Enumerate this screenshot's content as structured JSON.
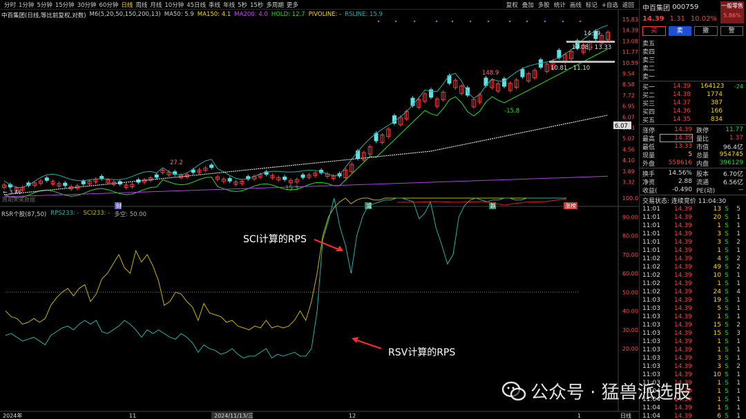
{
  "toolbar": {
    "timeframes": [
      "分时",
      "1分钟",
      "5分钟",
      "15分钟",
      "30分钟",
      "60分钟",
      "日线",
      "周线",
      "月线",
      "10分钟",
      "45日线",
      "季线",
      "年线",
      "5秒",
      "15秒",
      "多周期",
      "更多"
    ],
    "active_timeframe": "日线",
    "right_actions": [
      "复权",
      "叠加",
      "多股",
      "统计",
      "画线",
      "标记",
      "+自选",
      "返回"
    ]
  },
  "main_chart": {
    "title": "中百集团(日线,等比前复权,对数)",
    "indicators": [
      {
        "label": "M6(5,20,50,150,200,13)",
        "color": "#cccccc"
      },
      {
        "label": "MA50: 5.9",
        "color": "#cccccc"
      },
      {
        "label": "MA150: 4.1",
        "color": "#ffd700"
      },
      {
        "label": "MA200: 4.0",
        "color": "#d040ff"
      },
      {
        "label": "HOLD: 12.7",
        "color": "#1ee01e"
      },
      {
        "label": "PIVOLINE: -",
        "color": "#ffd700"
      },
      {
        "label": "RSLINE: 15.9",
        "color": "#20b2aa"
      }
    ],
    "y_axis": [
      "15.83",
      "14.39",
      "13.08",
      "11.77",
      "10.59",
      "9.54",
      "8.58",
      "7.72",
      "6.95",
      "6.07",
      "5.63",
      "5.07",
      "4.56",
      "4.10",
      "3.69",
      "3.32"
    ],
    "current_price_tag": "6.07",
    "annotations": {
      "high_label": "14.39",
      "range_upper": "13.08 - 13.33",
      "range_lower": "10.81 - 11.10",
      "peak_label": "148.9",
      "neg_label": "-15.8",
      "left_label": "27.2",
      "low_label": "15.3",
      "start_price": "3.46",
      "note": "周期未来数据"
    },
    "event_markers": [
      "财",
      "减",
      "跌",
      "涨榜"
    ]
  },
  "sub_chart": {
    "title": "RSR个股(87,50)",
    "rps_label": "RPS233: -",
    "sci_label": "SCI233: -",
    "multi_label": "多空: 50.00",
    "y_axis": [
      "100.0",
      "90.00",
      "80.00",
      "70.00",
      "60.00",
      "50.00",
      "40.00",
      "30.00",
      "20.00"
    ],
    "annotation_sci": "SCI计算的RPS",
    "annotation_rsv": "RSV计算的RPS"
  },
  "x_axis": {
    "labels": [
      "2024年",
      "11",
      "2024/11/13/三",
      "12",
      "1"
    ],
    "mode_label": "日线"
  },
  "chart_data": {
    "type": "line",
    "series": [
      {
        "name": "SCI233",
        "color": "#c8b400",
        "values": [
          40,
          37,
          36,
          33,
          34,
          36,
          34,
          36,
          43,
          47,
          50,
          52,
          48,
          52,
          54,
          45,
          49,
          57,
          60,
          65,
          70,
          63,
          60,
          72,
          66,
          70,
          64,
          56,
          43,
          45,
          50,
          49,
          45,
          42,
          35,
          44,
          39,
          38,
          37,
          34,
          35,
          32,
          31,
          30,
          32,
          31,
          35,
          31,
          32,
          31,
          32,
          35,
          40,
          35,
          45,
          60,
          80,
          90,
          95,
          98,
          100,
          97,
          99,
          100,
          100,
          99,
          99,
          100,
          100,
          100,
          100,
          100,
          100,
          100,
          100,
          100,
          100,
          100,
          100,
          100,
          100,
          100,
          100,
          100,
          100,
          100,
          100,
          100,
          100,
          100,
          100,
          100,
          100,
          100,
          100,
          100,
          100,
          100,
          100,
          100
        ]
      },
      {
        "name": "RPS233",
        "color": "#20b2aa",
        "values": [
          27,
          28,
          26,
          24,
          25,
          26,
          24,
          22,
          27,
          29,
          31,
          32,
          30,
          33,
          35,
          33,
          35,
          29,
          28,
          30,
          32,
          35,
          33,
          30,
          26,
          30,
          28,
          30,
          28,
          26,
          25,
          28,
          26,
          23,
          18,
          22,
          20,
          19,
          17,
          18,
          20,
          17,
          15,
          16,
          16,
          18,
          20,
          15,
          17,
          16,
          17,
          18,
          16,
          16,
          20,
          40,
          78,
          88,
          100,
          85,
          75,
          60,
          80,
          90,
          96,
          97,
          98,
          99,
          99,
          100,
          100,
          99,
          98,
          89,
          92,
          98,
          84,
          75,
          65,
          70,
          90,
          96,
          99,
          100,
          99,
          98,
          99,
          99,
          100,
          100,
          99,
          99,
          100,
          100,
          100,
          100,
          100,
          100,
          100,
          100
        ]
      }
    ],
    "ylim": [
      20,
      100
    ]
  },
  "right_panel": {
    "name": "中百集团",
    "code": "000759",
    "type_line1": "一般零售",
    "type_line2": "5.86%",
    "price": "14.39",
    "change": "1.31",
    "change_pct": "10.02%",
    "buttons": [
      "买",
      "卖",
      "撤",
      "警"
    ],
    "asks": [
      {
        "label": "卖五",
        "price": "",
        "vol": ""
      },
      {
        "label": "卖四",
        "price": "",
        "vol": ""
      },
      {
        "label": "卖三",
        "price": "",
        "vol": ""
      },
      {
        "label": "卖二",
        "price": "",
        "vol": ""
      },
      {
        "label": "卖一",
        "price": "",
        "vol": ""
      }
    ],
    "bids": [
      {
        "label": "买一",
        "price": "14.39",
        "vol": "164123",
        "chg": "-24"
      },
      {
        "label": "买二",
        "price": "14.38",
        "vol": "1774",
        "chg": ""
      },
      {
        "label": "买三",
        "price": "14.37",
        "vol": "387",
        "chg": ""
      },
      {
        "label": "买四",
        "price": "14.36",
        "vol": "166",
        "chg": ""
      },
      {
        "label": "买五",
        "price": "14.35",
        "vol": "834",
        "chg": ""
      }
    ],
    "stats": [
      {
        "k1": "涨停",
        "v1": "14.39",
        "c1": "red",
        "k2": "跌停",
        "v2": "11.77",
        "c2": "green"
      },
      {
        "k1": "最高",
        "v1": "14.39",
        "c1": "red",
        "k2": "量比",
        "v2": "1.37",
        "c2": "red"
      },
      {
        "k1": "最低",
        "v1": "13.33",
        "c1": "red",
        "k2": "市值",
        "v2": "96.4亿",
        "c2": "white"
      },
      {
        "k1": "现量",
        "v1": "5",
        "c1": "yellow",
        "k2": "总量",
        "v2": "954745",
        "c2": "yellow"
      },
      {
        "k1": "外盘",
        "v1": "558616",
        "c1": "red",
        "k2": "内盘",
        "v2": "396129",
        "c2": "green"
      },
      {
        "k1": "换手",
        "v1": "14.56%",
        "c1": "white",
        "k2": "股本",
        "v2": "6.70亿",
        "c2": "white"
      },
      {
        "k1": "净资",
        "v1": "2.88",
        "c1": "white",
        "k2": "流通",
        "v2": "6.56亿",
        "c2": "white"
      },
      {
        "k1": "收益(",
        "v1": "-0.490",
        "c1": "white",
        "k2": "PE(动)",
        "v2": "--",
        "c2": "white"
      }
    ],
    "trade_status": "交易状态: 连续竞价 11:04:30",
    "ticks": [
      {
        "t": "11:01",
        "p": "14.39",
        "v": "13",
        "s": "S",
        "n": "5"
      },
      {
        "t": "11:01",
        "p": "14.39",
        "v": "20",
        "s": "S",
        "n": "1"
      },
      {
        "t": "11:01",
        "p": "14.39",
        "v": "1",
        "s": "S",
        "n": "1"
      },
      {
        "t": "11:01",
        "p": "14.39",
        "v": "3",
        "s": "S",
        "n": "1"
      },
      {
        "t": "11:01",
        "p": "14.39",
        "v": "3",
        "s": "S",
        "n": "2"
      },
      {
        "t": "11:01",
        "p": "14.39",
        "v": "1",
        "s": "S",
        "n": "1"
      },
      {
        "t": "11:02",
        "p": "14.39",
        "v": "4",
        "s": "S",
        "n": "2"
      },
      {
        "t": "11:02",
        "p": "14.39",
        "v": "49",
        "s": "S",
        "n": "2"
      },
      {
        "t": "11:02",
        "p": "14.39",
        "v": "10",
        "s": "S",
        "n": "1"
      },
      {
        "t": "11:02",
        "p": "14.39",
        "v": "1",
        "s": "S",
        "n": "1"
      },
      {
        "t": "11:02",
        "p": "14.39",
        "v": "24",
        "s": "S",
        "n": "4"
      },
      {
        "t": "11:03",
        "p": "14.39",
        "v": "19",
        "s": "S",
        "n": "1"
      },
      {
        "t": "11:03",
        "p": "14.39",
        "v": "5",
        "s": "S",
        "n": "1"
      },
      {
        "t": "11:03",
        "p": "14.39",
        "v": "1",
        "s": "S",
        "n": "1"
      },
      {
        "t": "11:03",
        "p": "14.39",
        "v": "15",
        "s": "S",
        "n": "2"
      },
      {
        "t": "11:03",
        "p": "14.39",
        "v": "15",
        "s": "S",
        "n": "3"
      },
      {
        "t": "11:03",
        "p": "14.39",
        "v": "1",
        "s": "S",
        "n": "1"
      },
      {
        "t": "11:03",
        "p": "14.39",
        "v": "1",
        "s": "S",
        "n": "1"
      },
      {
        "t": "11:03",
        "p": "14.39",
        "v": "3",
        "s": "S",
        "n": "1"
      },
      {
        "t": "11:03",
        "p": "14.39",
        "v": "3",
        "s": "S",
        "n": "2"
      },
      {
        "t": "11:03",
        "p": "14.39",
        "v": "10",
        "s": "S",
        "n": "1"
      },
      {
        "t": "11:03",
        "p": "14.39",
        "v": "1",
        "s": "S",
        "n": "1"
      },
      {
        "t": "11:04",
        "p": "14.39",
        "v": "1",
        "s": "S",
        "n": "1"
      },
      {
        "t": "11:04",
        "p": "14.39",
        "v": "1",
        "s": "S",
        "n": "1"
      },
      {
        "t": "11:04",
        "p": "14.39",
        "v": "1",
        "s": "S",
        "n": "1"
      },
      {
        "t": "11:04",
        "p": "14.39",
        "v": "6",
        "s": "S",
        "n": "1"
      },
      {
        "t": "11:04",
        "p": "14.39",
        "v": "3",
        "s": "S",
        "n": "1"
      }
    ]
  },
  "watermark": {
    "text": "公众号 · 猛兽派选股"
  }
}
